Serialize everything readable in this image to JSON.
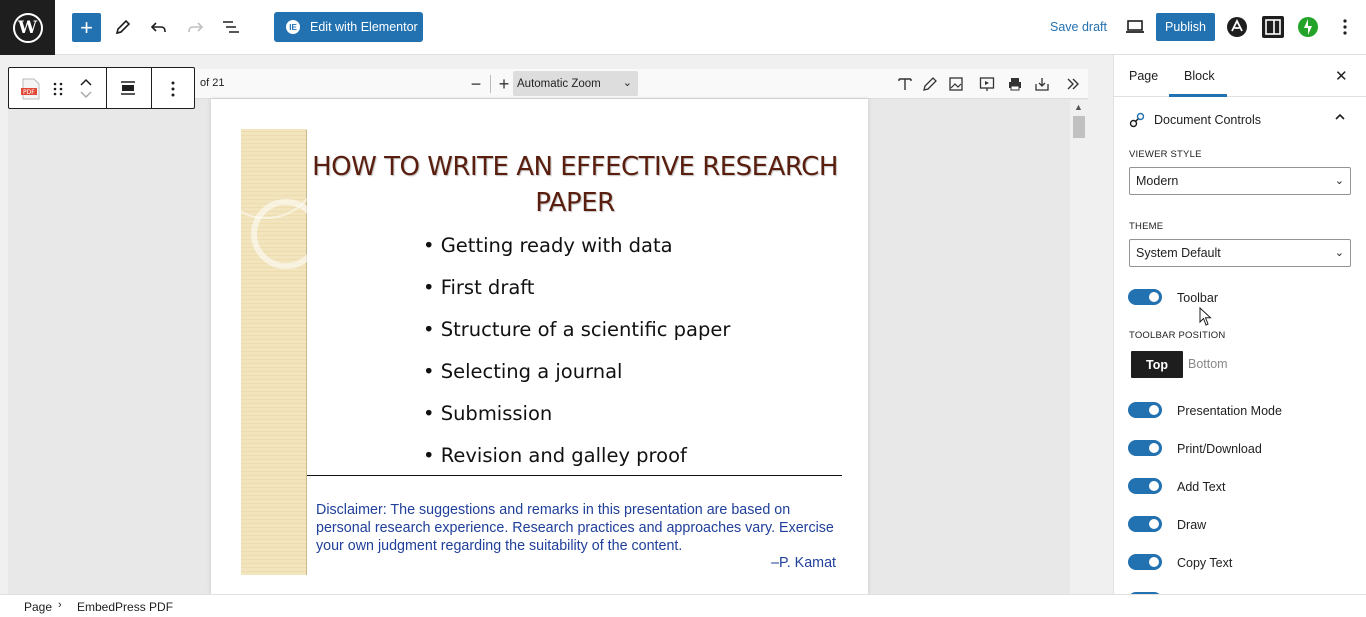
{
  "header": {
    "edit_elementor_label": "Edit with Elementor",
    "save_draft_label": "Save draft",
    "publish_label": "Publish"
  },
  "pdf_viewer": {
    "page_count": "of 21",
    "zoom_value": "Automatic Zoom"
  },
  "slide": {
    "title": "HOW TO WRITE AN EFFECTIVE RESEARCH PAPER",
    "bullets": [
      "• Getting ready with data",
      "• First draft",
      "• Structure of a scientific paper",
      "• Selecting a journal",
      "• Submission",
      "• Revision and galley proof"
    ],
    "disclaimer": "Disclaimer: The suggestions and remarks in this presentation are based on personal research experience. Research practices and approaches vary. Exercise your own judgment regarding the suitability of the content.",
    "signature": "–P. Kamat"
  },
  "sidebar": {
    "tabs": [
      {
        "label": "Page"
      },
      {
        "label": "Block"
      }
    ],
    "panel_title": "Document Controls",
    "viewer_style_label": "VIEWER STYLE",
    "viewer_style_value": "Modern",
    "theme_label": "THEME",
    "theme_value": "System Default",
    "toolbar_label": "Toolbar",
    "toolbar_position_label": "TOOLBAR POSITION",
    "position_top": "Top",
    "position_bottom": "Bottom",
    "toggles": [
      {
        "label": "Presentation Mode"
      },
      {
        "label": "Print/Download"
      },
      {
        "label": "Add Text"
      },
      {
        "label": "Draw"
      },
      {
        "label": "Copy Text"
      }
    ]
  },
  "breadcrumb": {
    "items": [
      "Page",
      "EmbedPress PDF"
    ]
  },
  "colors": {
    "accent": "#2271b1",
    "dark": "#1e1e1e",
    "slide_title": "#5a1e0e",
    "disclaimer": "#1f3f9a"
  }
}
